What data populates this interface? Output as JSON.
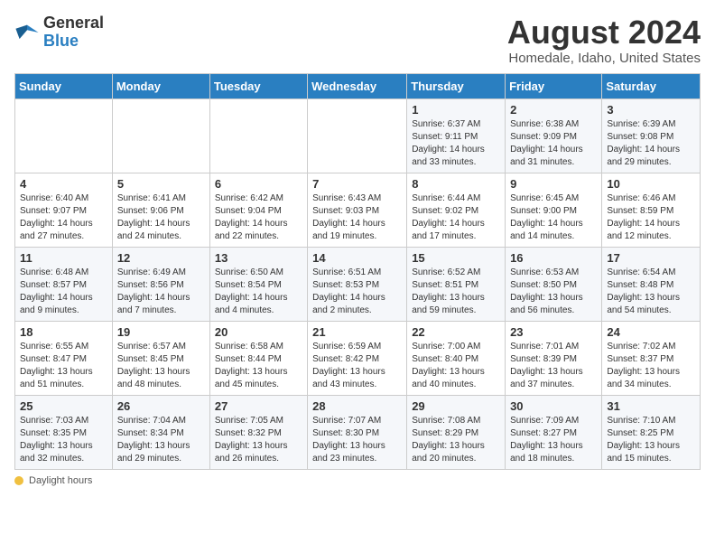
{
  "logo": {
    "general": "General",
    "blue": "Blue"
  },
  "title": "August 2024",
  "subtitle": "Homedale, Idaho, United States",
  "days_header": [
    "Sunday",
    "Monday",
    "Tuesday",
    "Wednesday",
    "Thursday",
    "Friday",
    "Saturday"
  ],
  "weeks": [
    [
      {
        "day": "",
        "info": ""
      },
      {
        "day": "",
        "info": ""
      },
      {
        "day": "",
        "info": ""
      },
      {
        "day": "",
        "info": ""
      },
      {
        "day": "1",
        "info": "Sunrise: 6:37 AM\nSunset: 9:11 PM\nDaylight: 14 hours and 33 minutes."
      },
      {
        "day": "2",
        "info": "Sunrise: 6:38 AM\nSunset: 9:09 PM\nDaylight: 14 hours and 31 minutes."
      },
      {
        "day": "3",
        "info": "Sunrise: 6:39 AM\nSunset: 9:08 PM\nDaylight: 14 hours and 29 minutes."
      }
    ],
    [
      {
        "day": "4",
        "info": "Sunrise: 6:40 AM\nSunset: 9:07 PM\nDaylight: 14 hours and 27 minutes."
      },
      {
        "day": "5",
        "info": "Sunrise: 6:41 AM\nSunset: 9:06 PM\nDaylight: 14 hours and 24 minutes."
      },
      {
        "day": "6",
        "info": "Sunrise: 6:42 AM\nSunset: 9:04 PM\nDaylight: 14 hours and 22 minutes."
      },
      {
        "day": "7",
        "info": "Sunrise: 6:43 AM\nSunset: 9:03 PM\nDaylight: 14 hours and 19 minutes."
      },
      {
        "day": "8",
        "info": "Sunrise: 6:44 AM\nSunset: 9:02 PM\nDaylight: 14 hours and 17 minutes."
      },
      {
        "day": "9",
        "info": "Sunrise: 6:45 AM\nSunset: 9:00 PM\nDaylight: 14 hours and 14 minutes."
      },
      {
        "day": "10",
        "info": "Sunrise: 6:46 AM\nSunset: 8:59 PM\nDaylight: 14 hours and 12 minutes."
      }
    ],
    [
      {
        "day": "11",
        "info": "Sunrise: 6:48 AM\nSunset: 8:57 PM\nDaylight: 14 hours and 9 minutes."
      },
      {
        "day": "12",
        "info": "Sunrise: 6:49 AM\nSunset: 8:56 PM\nDaylight: 14 hours and 7 minutes."
      },
      {
        "day": "13",
        "info": "Sunrise: 6:50 AM\nSunset: 8:54 PM\nDaylight: 14 hours and 4 minutes."
      },
      {
        "day": "14",
        "info": "Sunrise: 6:51 AM\nSunset: 8:53 PM\nDaylight: 14 hours and 2 minutes."
      },
      {
        "day": "15",
        "info": "Sunrise: 6:52 AM\nSunset: 8:51 PM\nDaylight: 13 hours and 59 minutes."
      },
      {
        "day": "16",
        "info": "Sunrise: 6:53 AM\nSunset: 8:50 PM\nDaylight: 13 hours and 56 minutes."
      },
      {
        "day": "17",
        "info": "Sunrise: 6:54 AM\nSunset: 8:48 PM\nDaylight: 13 hours and 54 minutes."
      }
    ],
    [
      {
        "day": "18",
        "info": "Sunrise: 6:55 AM\nSunset: 8:47 PM\nDaylight: 13 hours and 51 minutes."
      },
      {
        "day": "19",
        "info": "Sunrise: 6:57 AM\nSunset: 8:45 PM\nDaylight: 13 hours and 48 minutes."
      },
      {
        "day": "20",
        "info": "Sunrise: 6:58 AM\nSunset: 8:44 PM\nDaylight: 13 hours and 45 minutes."
      },
      {
        "day": "21",
        "info": "Sunrise: 6:59 AM\nSunset: 8:42 PM\nDaylight: 13 hours and 43 minutes."
      },
      {
        "day": "22",
        "info": "Sunrise: 7:00 AM\nSunset: 8:40 PM\nDaylight: 13 hours and 40 minutes."
      },
      {
        "day": "23",
        "info": "Sunrise: 7:01 AM\nSunset: 8:39 PM\nDaylight: 13 hours and 37 minutes."
      },
      {
        "day": "24",
        "info": "Sunrise: 7:02 AM\nSunset: 8:37 PM\nDaylight: 13 hours and 34 minutes."
      }
    ],
    [
      {
        "day": "25",
        "info": "Sunrise: 7:03 AM\nSunset: 8:35 PM\nDaylight: 13 hours and 32 minutes."
      },
      {
        "day": "26",
        "info": "Sunrise: 7:04 AM\nSunset: 8:34 PM\nDaylight: 13 hours and 29 minutes."
      },
      {
        "day": "27",
        "info": "Sunrise: 7:05 AM\nSunset: 8:32 PM\nDaylight: 13 hours and 26 minutes."
      },
      {
        "day": "28",
        "info": "Sunrise: 7:07 AM\nSunset: 8:30 PM\nDaylight: 13 hours and 23 minutes."
      },
      {
        "day": "29",
        "info": "Sunrise: 7:08 AM\nSunset: 8:29 PM\nDaylight: 13 hours and 20 minutes."
      },
      {
        "day": "30",
        "info": "Sunrise: 7:09 AM\nSunset: 8:27 PM\nDaylight: 13 hours and 18 minutes."
      },
      {
        "day": "31",
        "info": "Sunrise: 7:10 AM\nSunset: 8:25 PM\nDaylight: 13 hours and 15 minutes."
      }
    ]
  ],
  "footer": {
    "dot_label": "Daylight hours"
  }
}
